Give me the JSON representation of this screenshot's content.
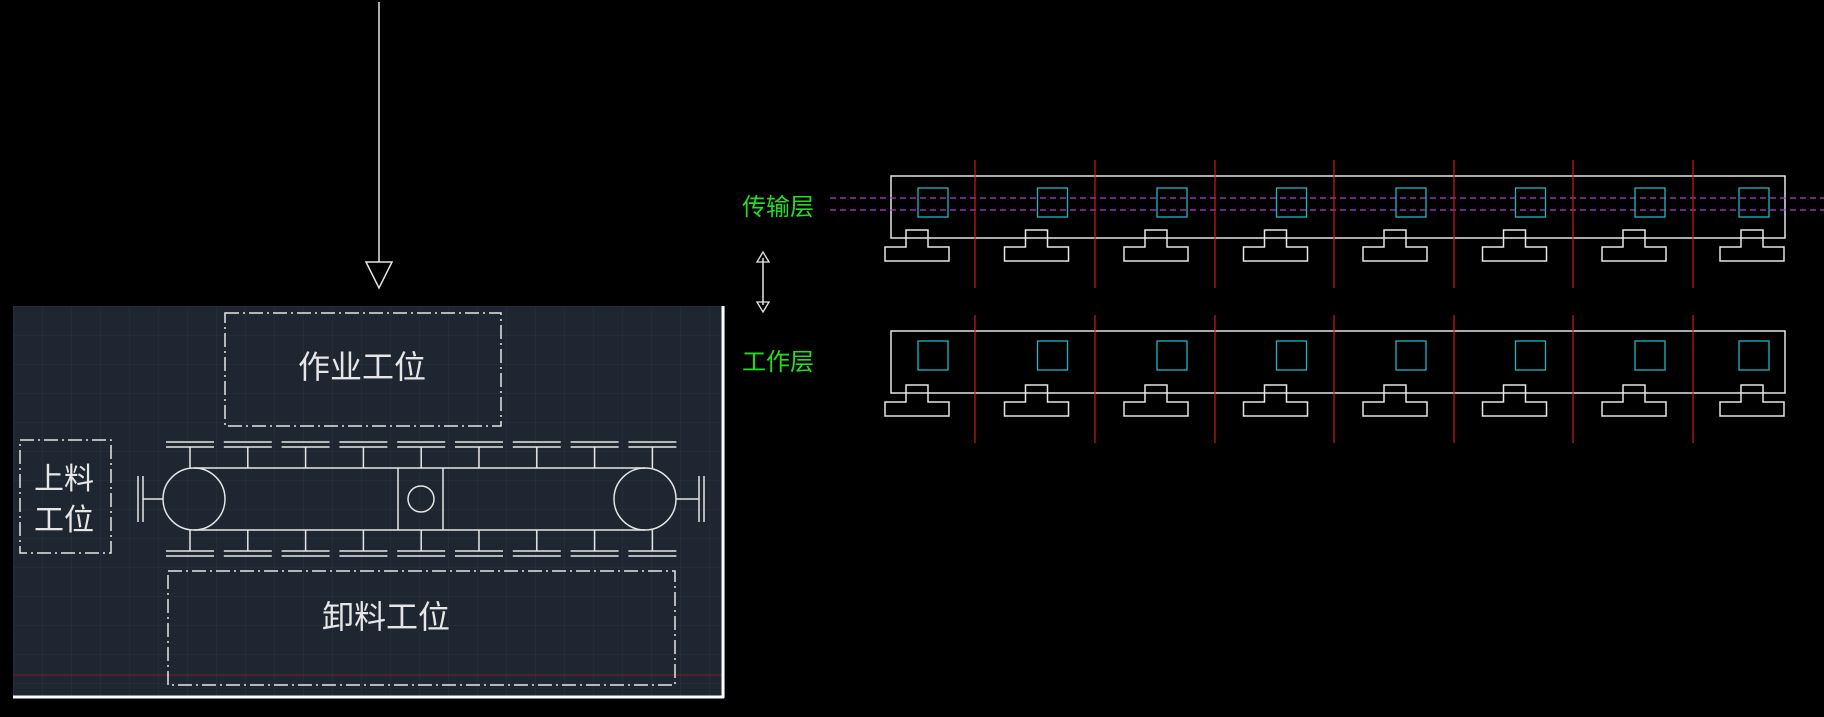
{
  "labels": {
    "work_station": "作业工位",
    "load_station_line1": "上料",
    "load_station_line2": "工位",
    "unload_station": "卸料工位",
    "transport_layer": "传输层",
    "work_layer": "工作层"
  },
  "colors": {
    "background": "#000000",
    "panel": "#1e2631",
    "line": "#e6e6e6",
    "red": "#d01a1a",
    "cyan": "#1fb5c2",
    "magenta": "#b23bd1",
    "green": "#22dd22"
  }
}
